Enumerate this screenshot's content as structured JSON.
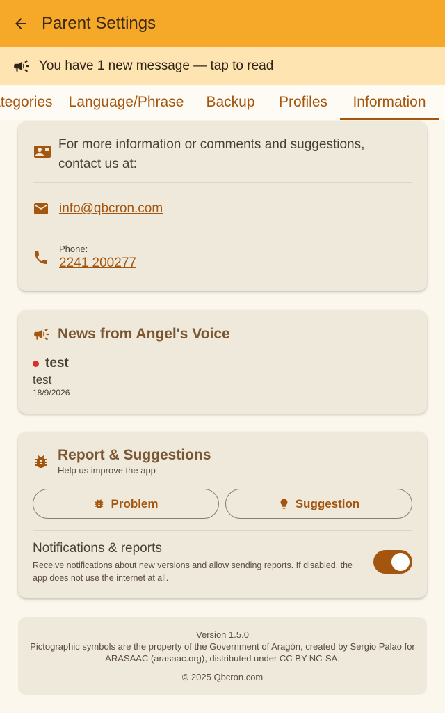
{
  "appbar": {
    "title": "Parent Settings",
    "back_icon": "arrow-back-icon"
  },
  "banner": {
    "text": "You have 1 new message — tap to read",
    "icon": "campaign-icon"
  },
  "tabs": [
    {
      "label": "Categories"
    },
    {
      "label": "Language/Phrase"
    },
    {
      "label": "Backup"
    },
    {
      "label": "Profiles"
    },
    {
      "label": "Information",
      "active": true
    }
  ],
  "contact": {
    "heading": "For more information or comments and suggestions, contact us at:",
    "email": "info@qbcron.com",
    "phone_label": "Phone:",
    "phone": "2241 200277"
  },
  "news": {
    "title": "News from Angel's Voice",
    "items": [
      {
        "title": "test",
        "body": "test",
        "date": "18/9/2026"
      }
    ]
  },
  "report": {
    "title": "Report & Suggestions",
    "subtitle": "Help us improve the app",
    "problem_label": "Problem",
    "suggestion_label": "Suggestion",
    "notifications_title": "Notifications & reports",
    "notifications_desc": "Receive notifications about new versions and allow sending reports. If disabled, the app does not use the internet at all.",
    "notifications_enabled": true
  },
  "footer": {
    "version": "Version 1.5.0",
    "credits": "Pictographic symbols are the property of the Government of Aragón, created by Sergio Palao for ARASAAC (arasaac.org), distributed under CC BY-NC-SA.",
    "copyright": "© 2025 Qbcron.com"
  },
  "colors": {
    "appbar": "#f6a828",
    "banner": "#fde4b0",
    "accent": "#a4560f",
    "card": "#efe9dc",
    "background": "#fcf7ec",
    "news_dot": "#d9302c"
  }
}
